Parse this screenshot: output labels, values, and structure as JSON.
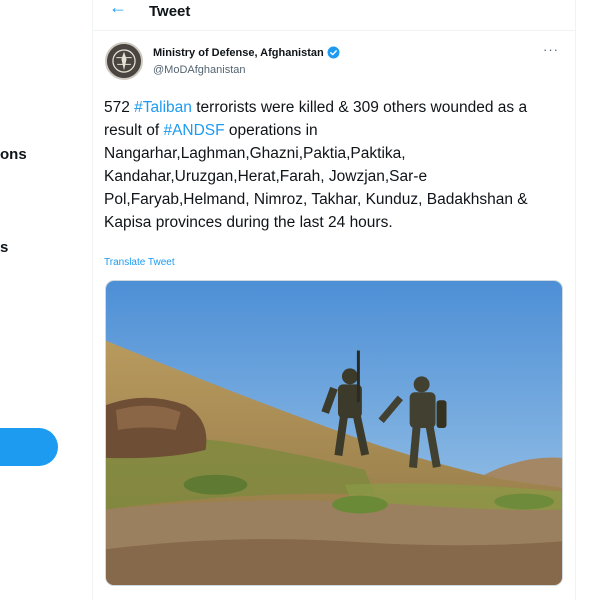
{
  "nav": {
    "items": [
      {
        "label": "ons"
      },
      {
        "label": "s"
      }
    ]
  },
  "header": {
    "back_icon": "arrow-left-icon",
    "title": "Tweet"
  },
  "author": {
    "name": "Ministry of Defense, Afghanistan",
    "handle": "@MoDAfghanistan",
    "verified_icon": "verified-badge-icon",
    "more_icon": "more-options-icon",
    "more_label": "···"
  },
  "tweet": {
    "segments": [
      {
        "text": "572 ",
        "link": false
      },
      {
        "text": "#Taliban",
        "link": true
      },
      {
        "text": " terrorists were killed & 309 others wounded as a result of ",
        "link": false
      },
      {
        "text": "#ANDSF",
        "link": true
      },
      {
        "text": " operations in Nangarhar,Laghman,Ghazni,Paktia,Paktika, Kandahar,Uruzgan,Herat,Farah, Jowzjan,Sar-e Pol,Faryab,Helmand, Nimroz, Takhar, Kunduz, Badakhshan & Kapisa provinces during the last 24 hours.",
        "link": false
      }
    ],
    "translate_label": "Translate Tweet"
  },
  "colors": {
    "accent": "#1d9bf0",
    "text": "#0f1419",
    "secondary": "#536471"
  }
}
